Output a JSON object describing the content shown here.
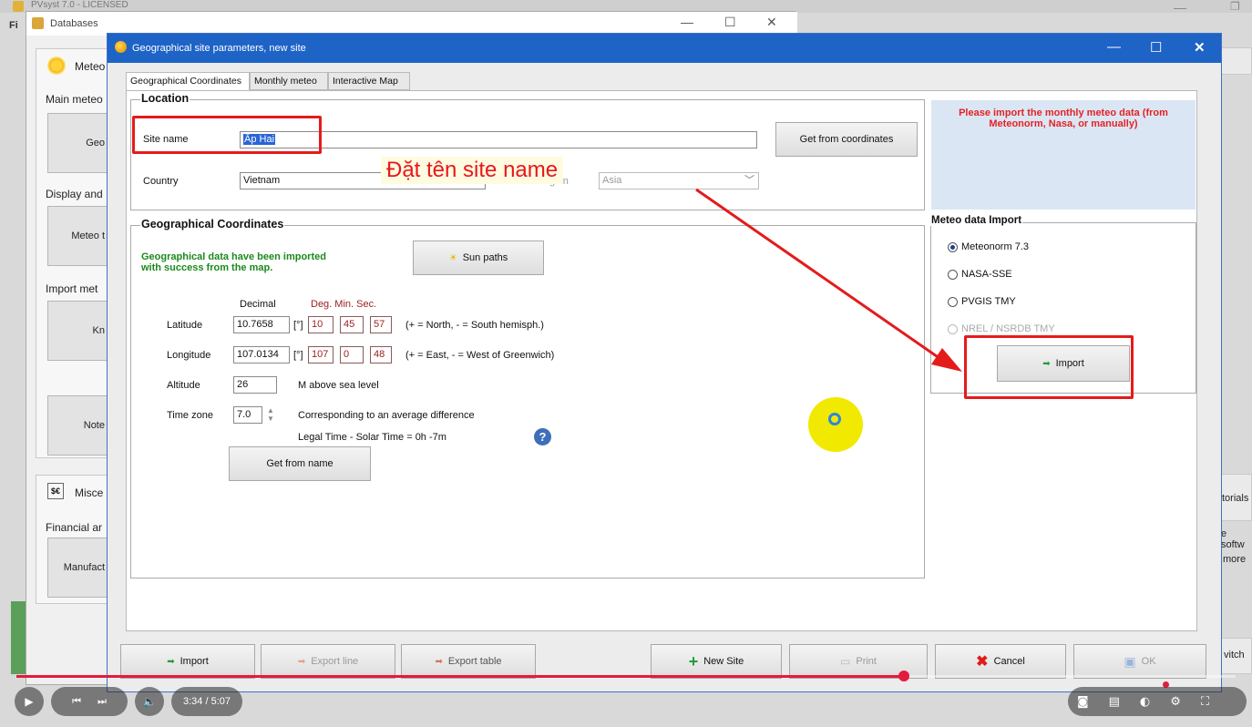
{
  "background_app": {
    "title": "PVsyst 7.0 - LICENSED",
    "menu_stub": "Fi",
    "right_tutorials": "torials",
    "right_software": "e softw",
    "right_more": "more",
    "right_switch": "vitch"
  },
  "db_window": {
    "title": "Databases",
    "meteo_section": "Meteo",
    "main_meteo_label": "Main meteo",
    "btn_geo": "Geo",
    "display_label": "Display and",
    "btn_meteo": "Meteo t",
    "import_label": "Import met",
    "btn_kn": "Kn",
    "btn_notes": "Note",
    "misc_section": "Misce",
    "financial_label": "Financial ar",
    "btn_manufact": "Manufact"
  },
  "dialog": {
    "title": "Geographical site parameters, new site",
    "tabs": [
      "Geographical Coordinates",
      "Monthly meteo",
      "Interactive Map"
    ],
    "location": {
      "group_title": "Location",
      "site_name_label": "Site name",
      "site_name_value": "Ấp Hai",
      "get_from_coordinates": "Get from coordinates",
      "country_label": "Country",
      "country_value": "Vietnam",
      "region_label": "Region",
      "region_value": "Asia"
    },
    "coords": {
      "group_title": "Geographical Coordinates",
      "import_msg_line1": "Geographical data have been imported",
      "import_msg_line2": "with success from the map.",
      "sun_paths": "Sun paths",
      "decimal_header": "Decimal",
      "dms_header": "Deg. Min. Sec.",
      "latitude_label": "Latitude",
      "latitude_value": "10.7658",
      "latitude_deg": "10",
      "latitude_min": "45",
      "latitude_sec": "57",
      "latitude_hint": "(+ = North, - = South hemisph.)",
      "longitude_label": "Longitude",
      "longitude_value": "107.0134",
      "longitude_deg": "107",
      "longitude_min": "0",
      "longitude_sec": "48",
      "longitude_hint": "(+ = East, - = West of Greenwich)",
      "degree_unit": "[°]",
      "altitude_label": "Altitude",
      "altitude_value": "26",
      "altitude_unit": "M above sea level",
      "timezone_label": "Time zone",
      "timezone_value": "7.0",
      "timezone_desc": "Corresponding to an average difference",
      "legal_time": "Legal Time - Solar Time =   0h -7m",
      "get_from_name": "Get from name"
    },
    "meteo_notice": "Please import the monthly meteo data (from Meteonorm, Nasa, or manually)",
    "meteo_import": {
      "group_title": "Meteo data Import",
      "options": [
        "Meteonorm 7.3",
        "NASA-SSE",
        "PVGIS TMY",
        "NREL / NSRDB TMY"
      ],
      "selected": "Meteonorm 7.3",
      "import_button": "Import"
    },
    "bottom_buttons": {
      "import": "Import",
      "export_line": "Export line",
      "export_table": "Export table",
      "new_site": "New Site",
      "print": "Print",
      "cancel": "Cancel",
      "ok": "OK"
    }
  },
  "annotation": {
    "caption": "Đặt tên site name",
    "color": "#e41b1b"
  },
  "player": {
    "time": "3:34 / 5:07",
    "progress": 0.728
  }
}
